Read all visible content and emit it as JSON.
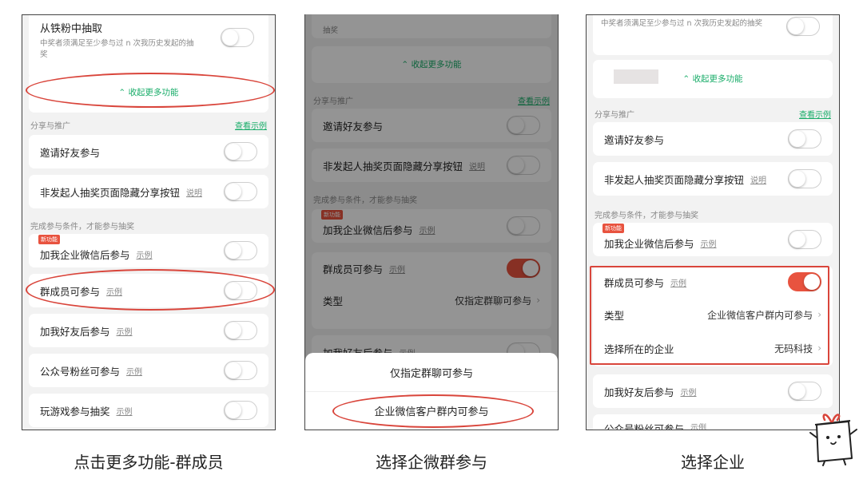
{
  "panel1": {
    "top_title": "从铁粉中抽取",
    "top_sub": "中奖者须满足至少参与过 n 次我历史发起的抽奖",
    "collapse": "收起更多功能",
    "share_header": "分享与推广",
    "view_example": "查看示例",
    "invite": "邀请好友参与",
    "hide_share": "非发起人抽奖页面隐藏分享按钮",
    "explain": "说明",
    "cond_header": "完成参与条件，才能参与抽奖",
    "new_badge": "新功能",
    "wecom": "加我企业微信后参与",
    "example": "示例",
    "group": "群成员可参与",
    "friend": "加我好友后参与",
    "fans": "公众号粉丝可参与",
    "game": "玩游戏参与抽奖"
  },
  "panel2": {
    "top_sub": "抽奖",
    "collapse": "收起更多功能",
    "share_header": "分享与推广",
    "view_example": "查看示例",
    "invite": "邀请好友参与",
    "hide_share": "非发起人抽奖页面隐藏分享按钮",
    "explain": "说明",
    "cond_header": "完成参与条件，才能参与抽奖",
    "new_badge": "新功能",
    "wecom": "加我企业微信后参与",
    "example": "示例",
    "group": "群成员可参与",
    "type_label": "类型",
    "type_value": "仅指定群聊可参与",
    "friend": "加我好友后参与",
    "sheet_options": [
      "仅指定群聊可参与",
      "企业微信客户群内可参与"
    ]
  },
  "panel3": {
    "top_sub": "中奖者须满足至少参与过 n 次我历史发起的抽奖",
    "collapse": "收起更多功能",
    "share_header": "分享与推广",
    "view_example": "查看示例",
    "invite": "邀请好友参与",
    "hide_share": "非发起人抽奖页面隐藏分享按钮",
    "explain": "说明",
    "cond_header": "完成参与条件，才能参与抽奖",
    "new_badge": "新功能",
    "wecom": "加我企业微信后参与",
    "example": "示例",
    "group": "群成员可参与",
    "type_label": "类型",
    "type_value": "企业微信客户群内可参与",
    "company_label": "选择所在的企业",
    "company_value": "无码科技",
    "friend": "加我好友后参与",
    "fans": "公众号粉丝可参与"
  },
  "captions": [
    "点击更多功能-群成员",
    "选择企微群参与",
    "选择企业"
  ],
  "colors": {
    "accent_green": "#1aad6a",
    "toggle_on": "#e8533f",
    "highlight_red": "#d9453b"
  }
}
